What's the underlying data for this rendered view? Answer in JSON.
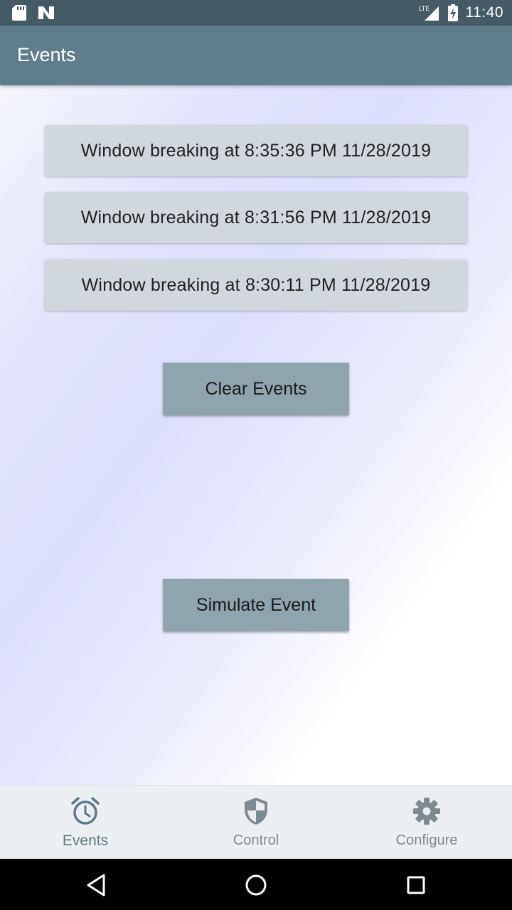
{
  "status_bar": {
    "time": "11:40",
    "network_label": "LTE",
    "icons": [
      "sd-card-icon",
      "n-notification-icon",
      "lte-signal-icon",
      "battery-charging-icon"
    ]
  },
  "app_bar": {
    "title": "Events"
  },
  "events": [
    {
      "text": "Window breaking at 8:35:36 PM 11/28/2019"
    },
    {
      "text": "Window breaking at 8:31:56 PM 11/28/2019"
    },
    {
      "text": "Window breaking at 8:30:11 PM 11/28/2019"
    }
  ],
  "buttons": {
    "clear_events": "Clear Events",
    "simulate_event": "Simulate Event"
  },
  "bottom_nav": {
    "items": [
      {
        "label": "Events",
        "icon": "alarm-clock-icon",
        "active": true
      },
      {
        "label": "Control",
        "icon": "shield-icon",
        "active": false
      },
      {
        "label": "Configure",
        "icon": "gear-icon",
        "active": false
      }
    ]
  },
  "system_nav": {
    "icons": [
      "back-icon",
      "home-icon",
      "recents-icon"
    ]
  },
  "colors": {
    "status_bar": "#455a64",
    "app_bar": "#607d8b",
    "event_card": "#d1d8dd",
    "action_button": "#90a4ae",
    "nav_active": "#5c7a88",
    "nav_inactive": "#7d8a91"
  }
}
